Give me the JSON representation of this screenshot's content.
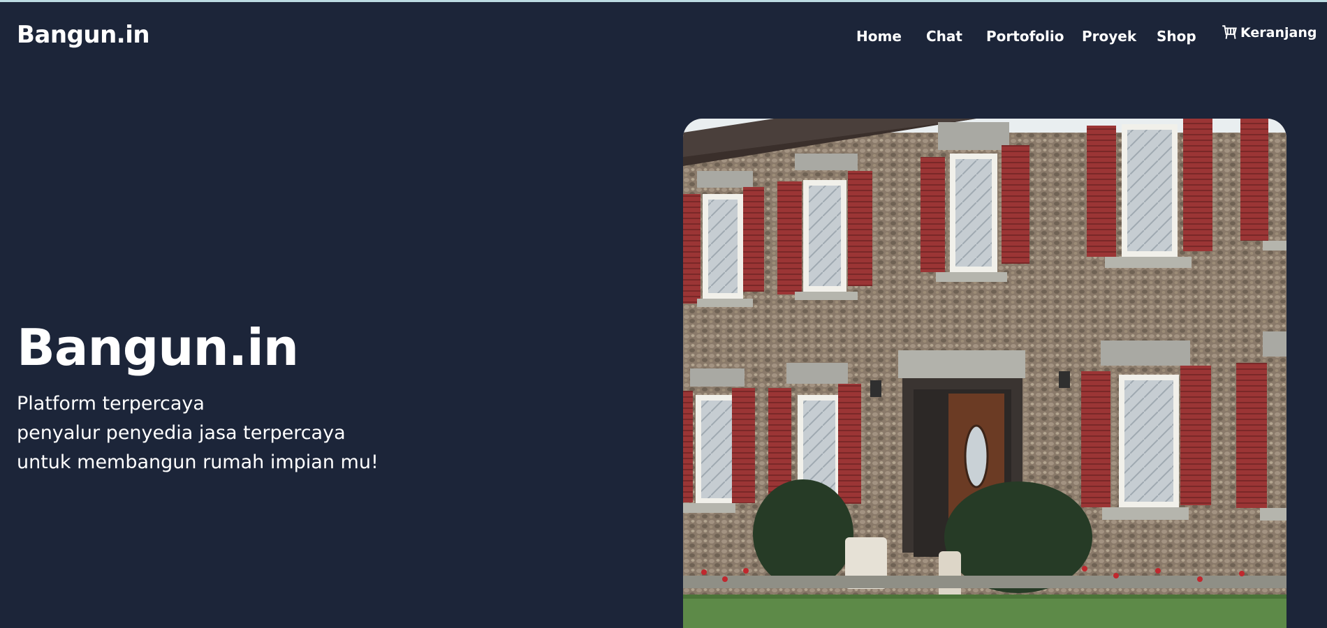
{
  "header": {
    "brand": "Bangun.in",
    "nav": [
      {
        "label": "Home"
      },
      {
        "label": "Chat"
      },
      {
        "label": "Portofolio"
      },
      {
        "label": "Proyek"
      },
      {
        "label": "Shop"
      }
    ],
    "cart": {
      "label": "Keranjang",
      "icon": "cart-icon"
    }
  },
  "hero": {
    "title": "Bangun.in",
    "lines": [
      "Platform terpercaya",
      "penyalur penyedia jasa terpercaya",
      "untuk membangun rumah impian mu!"
    ],
    "image": "house-photo"
  },
  "colors": {
    "background": "#1c2539",
    "text": "#ffffff",
    "shutter": "#9b3535",
    "stone": "#8a7a6a"
  }
}
